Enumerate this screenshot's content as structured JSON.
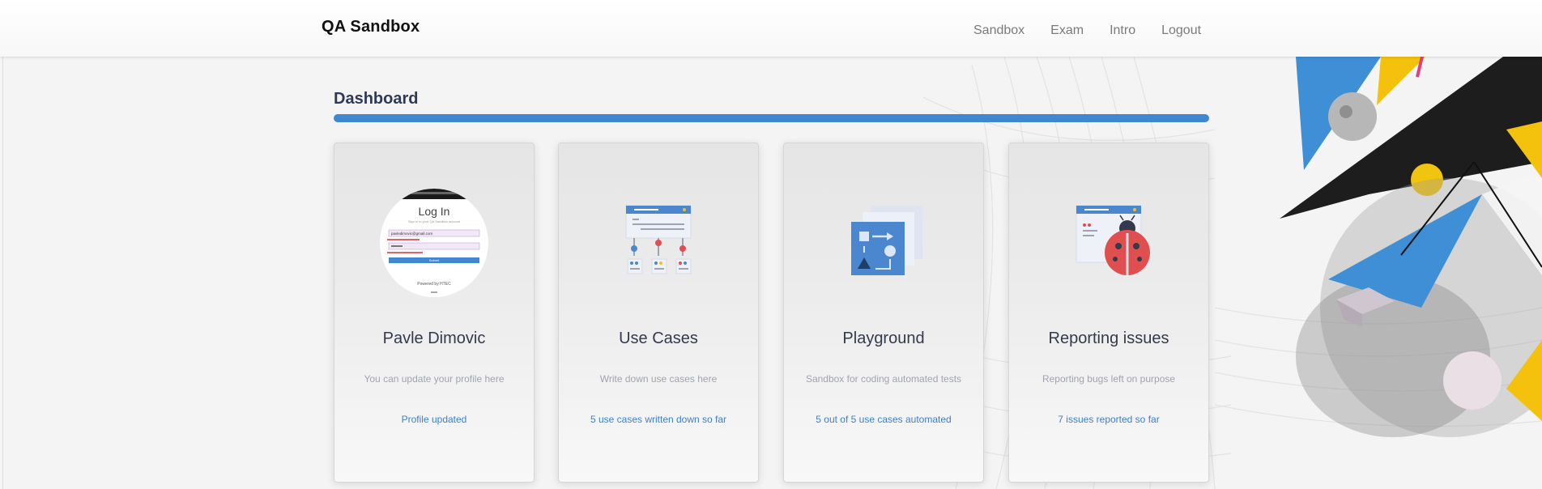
{
  "navbar": {
    "brand": "QA Sandbox",
    "links": [
      {
        "label": "Sandbox"
      },
      {
        "label": "Exam"
      },
      {
        "label": "Intro"
      },
      {
        "label": "Logout"
      }
    ]
  },
  "dashboard": {
    "title": "Dashboard",
    "accent_color": "#3f87cf"
  },
  "cards": [
    {
      "title": "Pavle Dimovic",
      "description": "You can update your profile here",
      "status": "Profile updated",
      "icon": "login-screenshot-avatar",
      "avatar": {
        "header": "Log In",
        "subheader": "Sign in to your QA Sandbox account",
        "email": "pavledimovic@gmail.com",
        "button": "Submit",
        "footer": "Powered by HTEC"
      }
    },
    {
      "title": "Use Cases",
      "description": "Write down use cases here",
      "status": "5 use cases written down so far",
      "icon": "use-case-flow-icon"
    },
    {
      "title": "Playground",
      "description": "Sandbox for coding automated tests",
      "status": "5 out of 5 use cases automated",
      "icon": "playground-shapes-icon"
    },
    {
      "title": "Reporting issues",
      "description": "Reporting bugs left on purpose",
      "status": "7 issues reported so far",
      "icon": "ladybug-bug-icon"
    }
  ]
}
